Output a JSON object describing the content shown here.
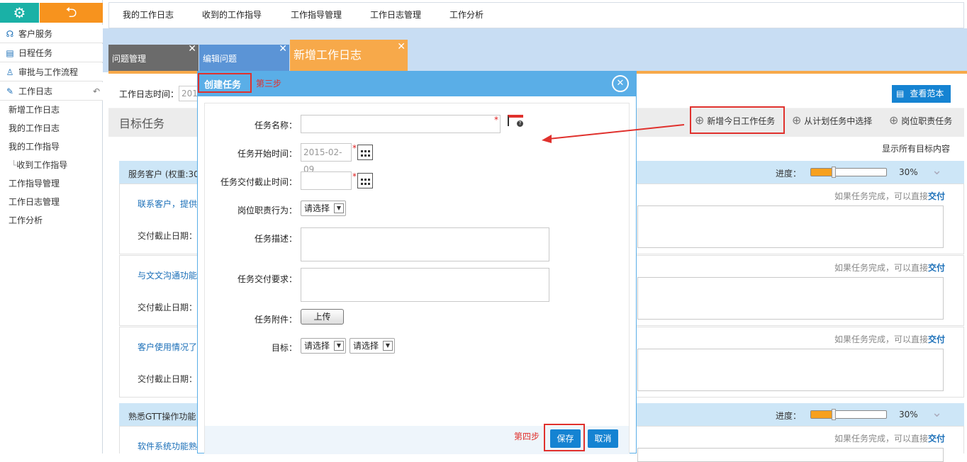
{
  "sidebar": {
    "items": [
      {
        "icon": "headset-icon",
        "label": "客户服务"
      },
      {
        "icon": "calendar-icon",
        "label": "日程任务"
      },
      {
        "icon": "approval-icon",
        "label": "审批与工作流程"
      },
      {
        "icon": "edit-icon",
        "label": "工作日志"
      }
    ],
    "subitems": [
      "新增工作日志",
      "我的工作日志",
      "我的工作指导",
      "收到工作指导",
      "工作指导管理",
      "工作日志管理",
      "工作分析"
    ]
  },
  "topnav": [
    "我的工作日志",
    "收到的工作指导",
    "工作指导管理",
    "工作日志管理",
    "工作分析"
  ],
  "tabs": [
    {
      "label": "问题管理",
      "color": "#6b6b6b"
    },
    {
      "label": "编辑问题",
      "color": "#5b94d6"
    },
    {
      "label": "新增工作日志",
      "color": "#f7a94a"
    }
  ],
  "main": {
    "date_label": "工作日志时间：",
    "date_value": "201",
    "view_example": "查看范本",
    "goal_title": "目标任务",
    "add_today": "新增今日工作任务",
    "from_plan": "从计划任务中选择",
    "duty_task": "岗位职责任务",
    "show_all": "显示所有目标内容",
    "sections": [
      {
        "title": "服务客户 (权重:30",
        "progress_label": "进度：",
        "progress_text": "30%",
        "progress_value": 0.3,
        "tasks": [
          {
            "name": "联系客户，提供",
            "deadline": "交付截止日期：",
            "hint": "如果任务完成，可以直接",
            "deliver": "交付"
          },
          {
            "name": "与文文沟通功能",
            "deadline": "交付截止日期：",
            "hint": "如果任务完成，可以直接",
            "deliver": "交付"
          },
          {
            "name": "客户使用情况了",
            "deadline": "交付截止日期：",
            "hint": "如果任务完成，可以直接",
            "deliver": "交付"
          }
        ]
      },
      {
        "title": "熟悉GTT操作功能",
        "progress_label": "进度：",
        "progress_text": "30%",
        "progress_value": 0.3,
        "tasks": [
          {
            "name": "软件系统功能熟",
            "hint": "如果任务完成，可以直接",
            "deliver": "交付"
          }
        ]
      }
    ]
  },
  "dialog": {
    "title": "创建任务",
    "step3": "第三步",
    "step4": "第四步",
    "fields": {
      "task_name": "任务名称：",
      "start_time": "任务开始时间：",
      "start_value": "2015-02-09",
      "deliver_time": "任务交付截止时间：",
      "duty_behavior": "岗位职责行为：",
      "select_placeholder": "请选择",
      "desc": "任务描述：",
      "requirement": "任务交付要求：",
      "attachment": "任务附件：",
      "upload": "上传",
      "target": "目标："
    },
    "save": "保存",
    "cancel": "取消"
  },
  "colors": {
    "accent": "#f7a94a",
    "blue": "#1583d2",
    "annotation": "#e0312d"
  }
}
